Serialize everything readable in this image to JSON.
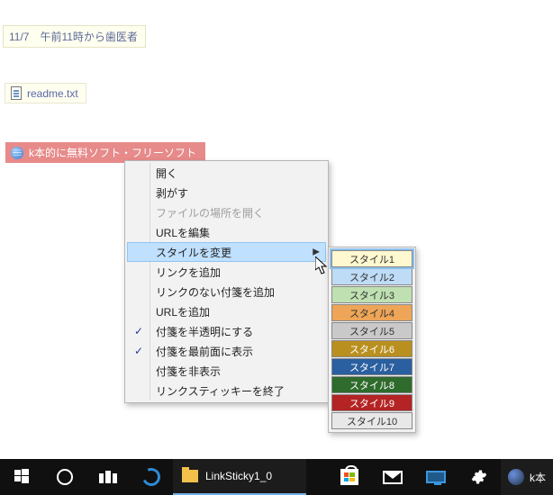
{
  "stickies": {
    "note1": "11/7　午前11時から歯医者",
    "file_label": "readme.txt",
    "link_label": "k本的に無料ソフト・フリーソフト"
  },
  "context_menu": {
    "items": [
      {
        "label": "開く",
        "disabled": false
      },
      {
        "label": "剥がす",
        "disabled": false
      },
      {
        "label": "ファイルの場所を開く",
        "disabled": true
      },
      {
        "label": "URLを編集",
        "disabled": false
      },
      {
        "label": "スタイルを変更",
        "disabled": false,
        "submenu": true,
        "highlight": true
      },
      {
        "label": "リンクを追加",
        "disabled": false
      },
      {
        "label": "リンクのない付箋を追加",
        "disabled": false
      },
      {
        "label": "URLを追加",
        "disabled": false
      },
      {
        "label": "付箋を半透明にする",
        "disabled": false,
        "checked": true
      },
      {
        "label": "付箋を最前面に表示",
        "disabled": false,
        "checked": true
      },
      {
        "label": "付箋を非表示",
        "disabled": false
      },
      {
        "label": "リンクスティッキーを終了",
        "disabled": false
      }
    ]
  },
  "style_submenu": {
    "items": [
      {
        "label": "スタイル1",
        "bg": "#fff8d0",
        "fg": "#333",
        "selected": true
      },
      {
        "label": "スタイル2",
        "bg": "#bedcf5",
        "fg": "#333"
      },
      {
        "label": "スタイル3",
        "bg": "#bfe0b1",
        "fg": "#333"
      },
      {
        "label": "スタイル4",
        "bg": "#eea557",
        "fg": "#333"
      },
      {
        "label": "スタイル5",
        "bg": "#c9c9c9",
        "fg": "#333"
      },
      {
        "label": "スタイル6",
        "bg": "#b98f1f",
        "fg": "#ffffff"
      },
      {
        "label": "スタイル7",
        "bg": "#2a5fa0",
        "fg": "#ffffff"
      },
      {
        "label": "スタイル8",
        "bg": "#2f6b2c",
        "fg": "#ffffff"
      },
      {
        "label": "スタイル9",
        "bg": "#b42424",
        "fg": "#ffffff"
      },
      {
        "label": "スタイル10",
        "bg": "#e8e8e8",
        "fg": "#333"
      }
    ]
  },
  "taskbar": {
    "explorer_label": "LinkSticky1_0",
    "pinned_label": "k本"
  }
}
